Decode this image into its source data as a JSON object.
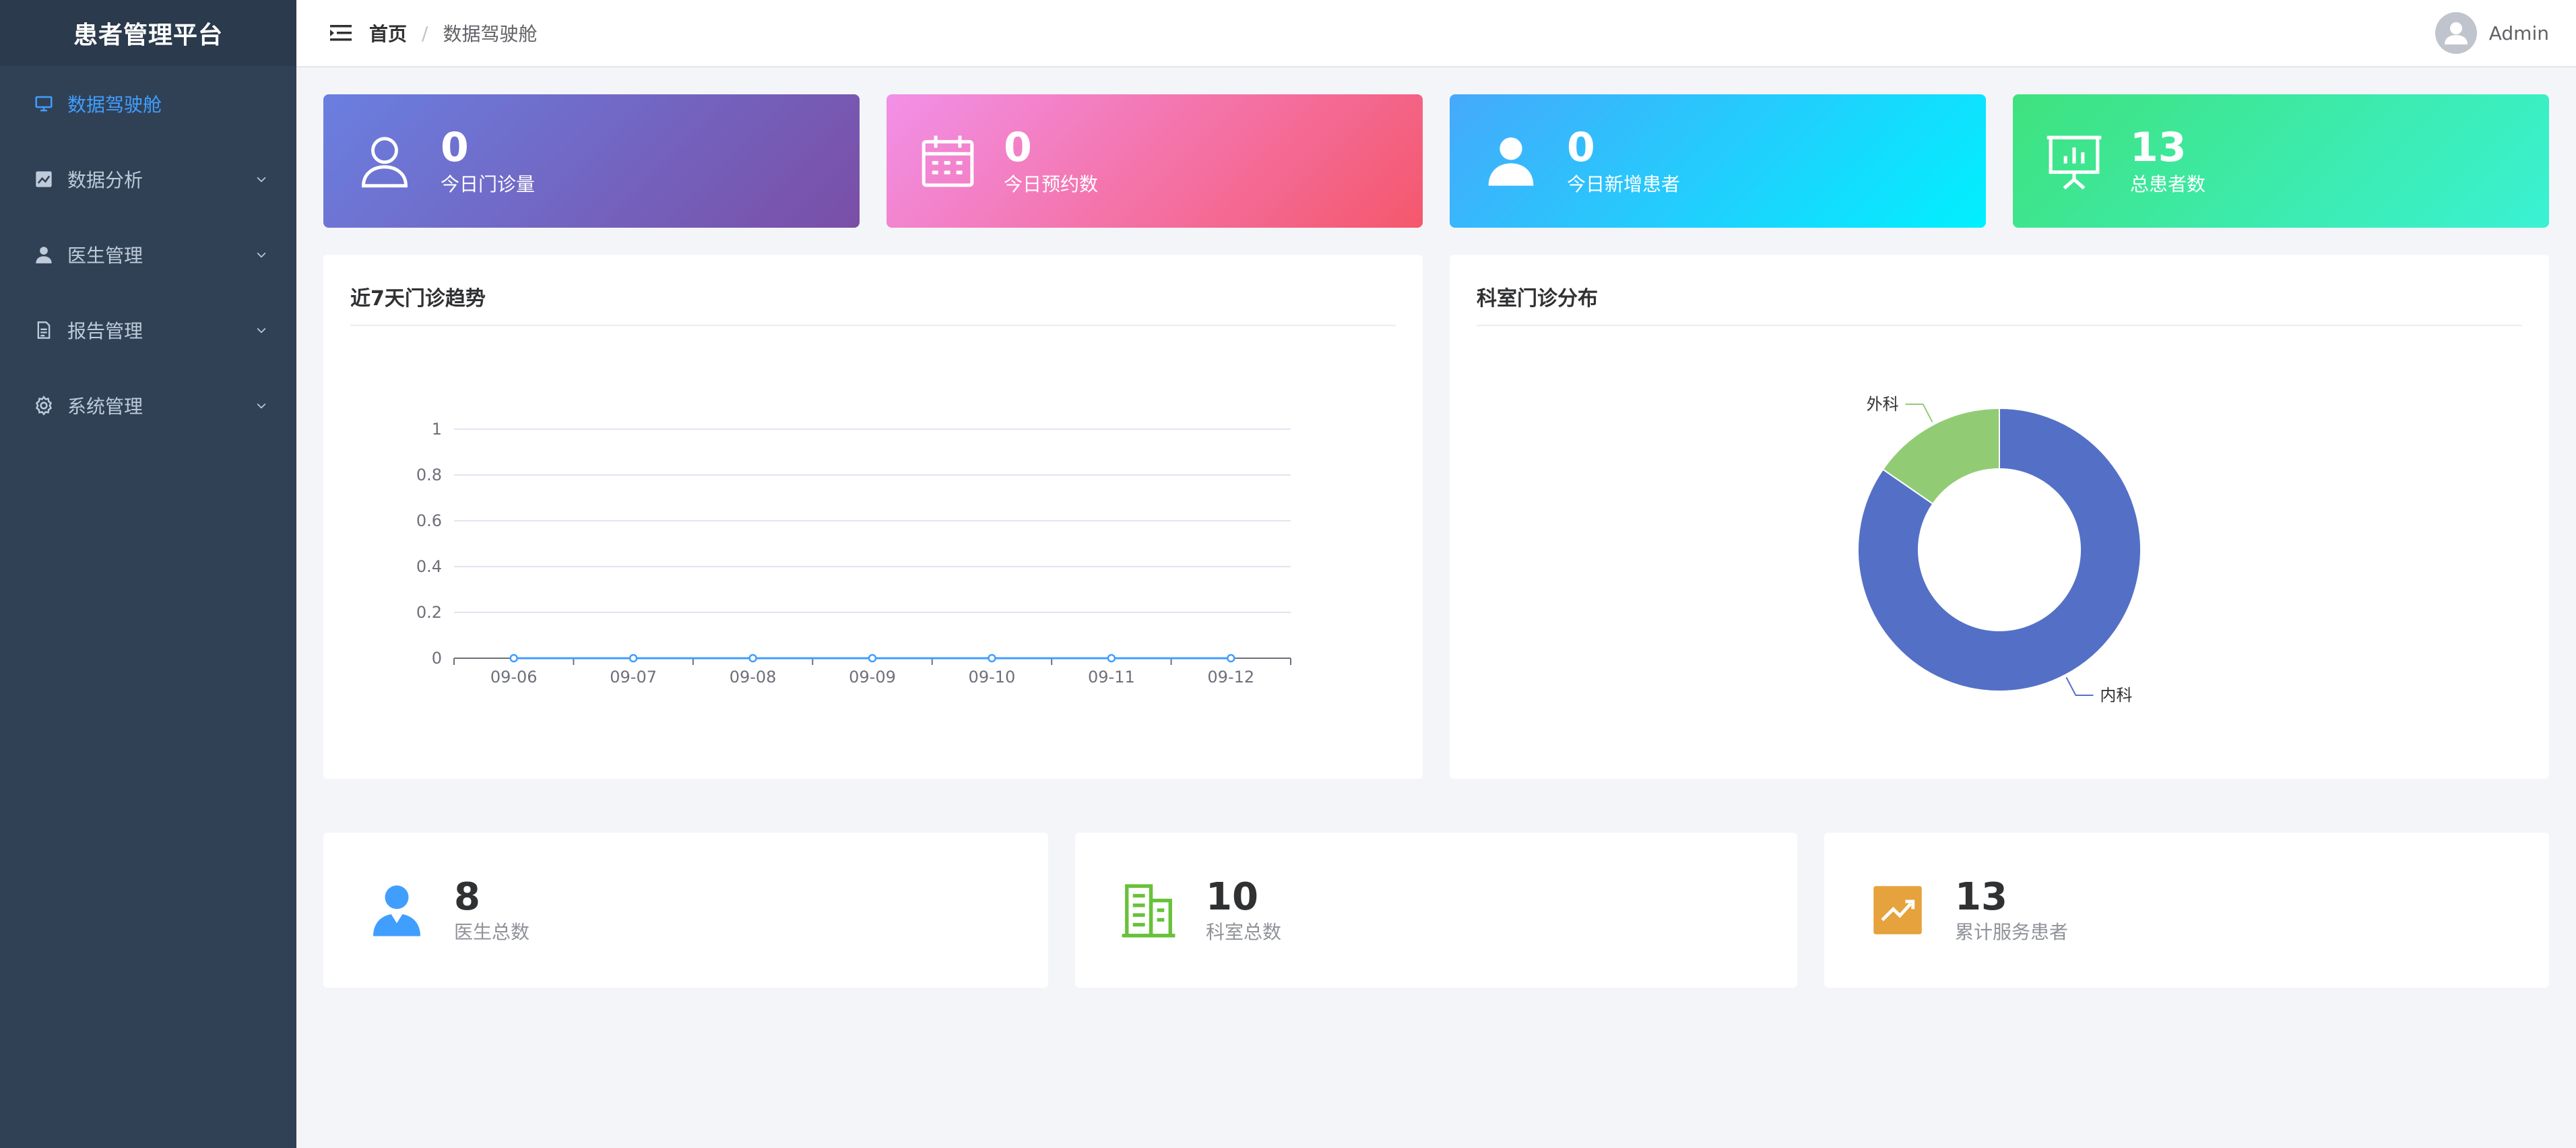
{
  "brand": {
    "title": "患者管理平台"
  },
  "sidebar": {
    "items": [
      {
        "label": "数据驾驶舱",
        "icon": "monitor-icon",
        "active": true
      },
      {
        "label": "数据分析",
        "icon": "chart-icon",
        "active": false
      },
      {
        "label": "医生管理",
        "icon": "user-icon",
        "active": false
      },
      {
        "label": "报告管理",
        "icon": "document-icon",
        "active": false
      },
      {
        "label": "系统管理",
        "icon": "gear-icon",
        "active": false
      }
    ]
  },
  "header": {
    "breadcrumb_home": "首页",
    "breadcrumb_sep": "/",
    "breadcrumb_current": "数据驾驶舱",
    "username": "Admin"
  },
  "stats": [
    {
      "value": "0",
      "label": "今日门诊量",
      "icon": "user-outline-icon"
    },
    {
      "value": "0",
      "label": "今日预约数",
      "icon": "calendar-icon"
    },
    {
      "value": "0",
      "label": "今日新增患者",
      "icon": "user-solid-icon"
    },
    {
      "value": "13",
      "label": "总患者数",
      "icon": "presentation-board-icon"
    }
  ],
  "panels": {
    "line_title": "近7天门诊趋势",
    "pie_title": "科室门诊分布"
  },
  "chart_data": [
    {
      "type": "line",
      "x": [
        "09-06",
        "09-07",
        "09-08",
        "09-09",
        "09-10",
        "09-11",
        "09-12"
      ],
      "series": [
        {
          "values": [
            0,
            0,
            0,
            0,
            0,
            0,
            0
          ]
        }
      ],
      "ylim": [
        0,
        1
      ],
      "yticks": [
        "0",
        "0.2",
        "0.4",
        "0.6",
        "0.8",
        "1"
      ],
      "grid": true,
      "color": "#409eff"
    },
    {
      "type": "pie",
      "donut": true,
      "categories": [
        "内科",
        "外科"
      ],
      "values": [
        11,
        2
      ],
      "colors": [
        "#5470c6",
        "#91cc75"
      ]
    }
  ],
  "info_cards": [
    {
      "value": "8",
      "label": "医生总数",
      "icon": "doctor-icon",
      "color": "#409eff"
    },
    {
      "value": "10",
      "label": "科室总数",
      "icon": "building-icon",
      "color": "#67c23a"
    },
    {
      "value": "13",
      "label": "累计服务患者",
      "icon": "trend-up-icon",
      "color": "#e6a23c"
    }
  ]
}
